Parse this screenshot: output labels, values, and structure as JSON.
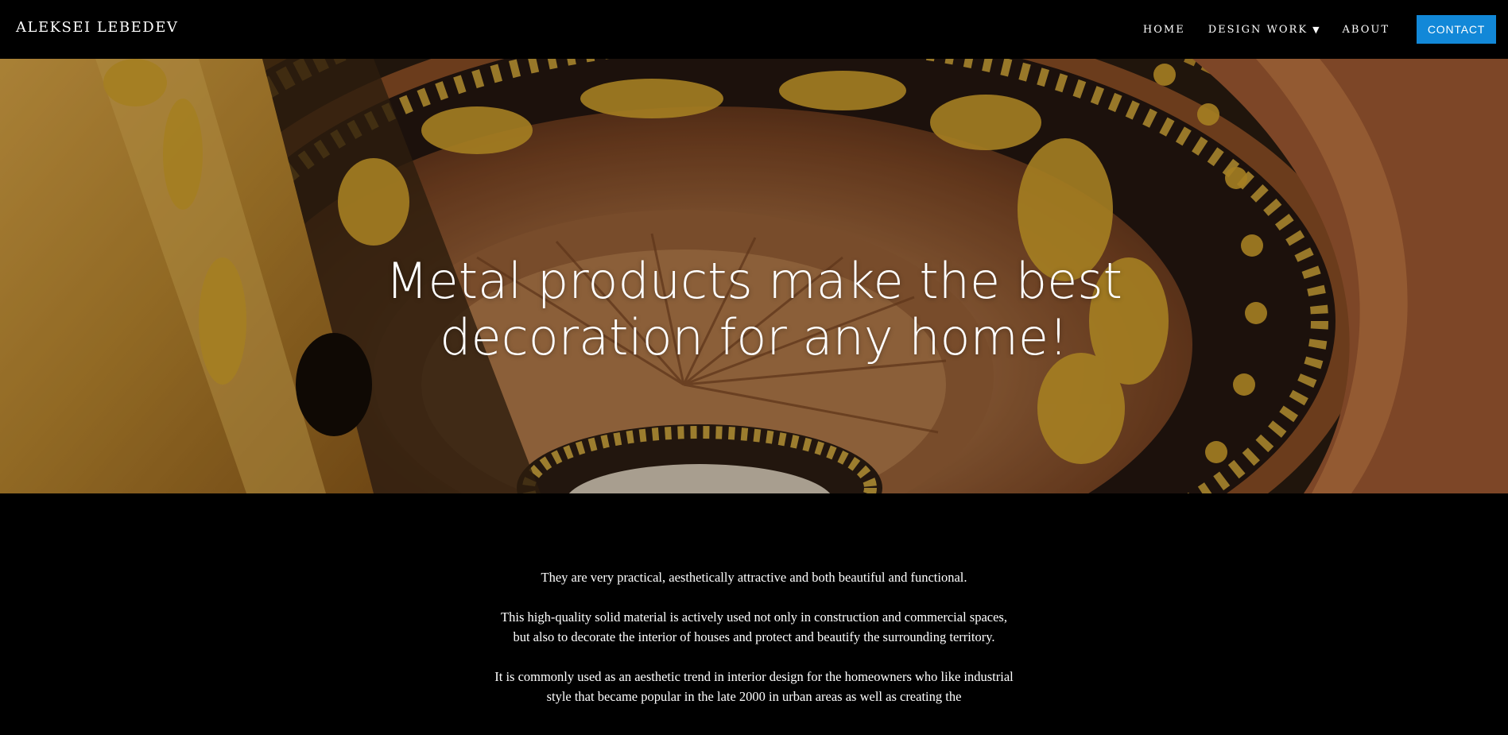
{
  "header": {
    "brand": "ALEKSEI LEBEDEV",
    "nav": {
      "home": "HOME",
      "design_work": "DESIGN WORK",
      "design_work_caret": "▼",
      "about": "ABOUT",
      "contact": "CONTACT"
    }
  },
  "hero": {
    "title_line1": "Metal products make the best",
    "title_line2": "decoration for any home!"
  },
  "content": {
    "p1": "They are very practical, aesthetically attractive and both beautiful and functional.",
    "p2": "This high-quality solid material is actively used not only in construction and commercial spaces, but also to decorate the interior of houses and protect and beautify the surrounding territory.",
    "p3": "It is commonly used as an aesthetic trend in interior design for the homeowners who like industrial style that became popular in the late 2000 in urban areas as well as creating the"
  },
  "colors": {
    "background": "#000000",
    "accent": "#1288d8",
    "text": "#ffffff"
  }
}
